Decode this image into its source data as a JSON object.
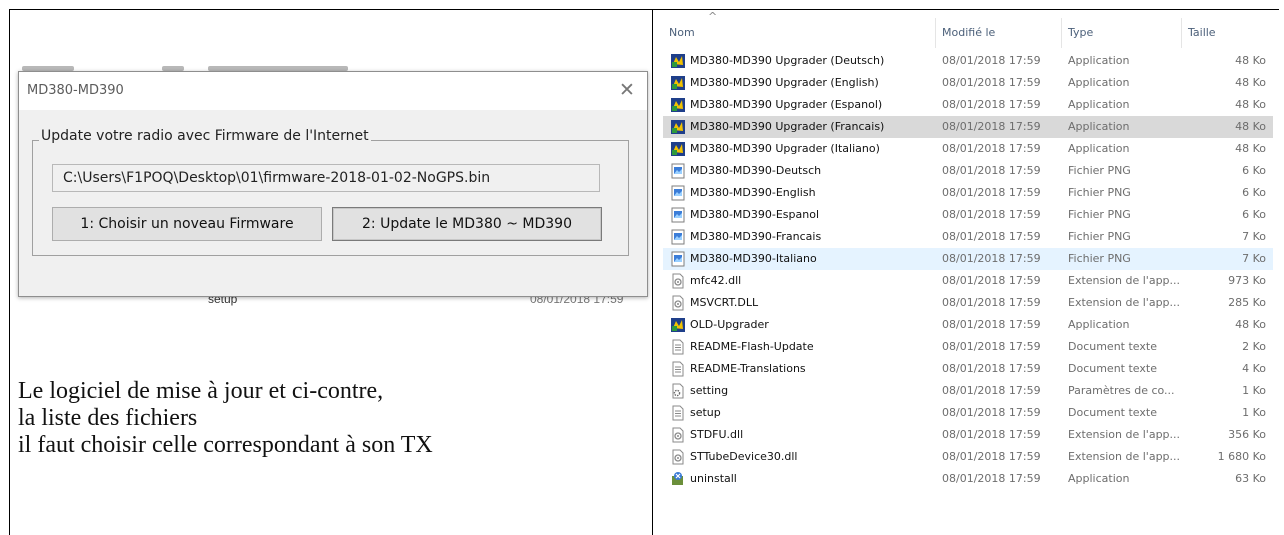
{
  "dialog": {
    "title": "MD380-MD390",
    "close_glyph": "✕",
    "group_label": "Update votre radio avec Firmware de l'Internet",
    "path": "C:\\Users\\F1POQ\\Desktop\\01\\firmware-2018-01-02-NoGPS.bin",
    "button_choose": "1: Choisir un noveau Firmware",
    "button_update": "2: Update le MD380 ~ MD390"
  },
  "background_window": {
    "bottom_item": "setup",
    "bottom_date": "08/01/2018 17:59"
  },
  "caption": {
    "line1": "Le logiciel de mise à jour et ci-contre,",
    "line2": "la liste des fichiers",
    "line3": "il faut choisir celle correspondant à son TX"
  },
  "explorer": {
    "sort_glyph": "^",
    "headers": {
      "name": "Nom",
      "modified": "Modifié le",
      "type": "Type",
      "size": "Taille"
    },
    "files": [
      {
        "name": "MD380-MD390 Upgrader (Deutsch)",
        "date": "08/01/2018 17:59",
        "type": "Application",
        "size": "48 Ko",
        "icon": "app-icon"
      },
      {
        "name": "MD380-MD390 Upgrader (English)",
        "date": "08/01/2018 17:59",
        "type": "Application",
        "size": "48 Ko",
        "icon": "app-icon"
      },
      {
        "name": "MD380-MD390 Upgrader (Espanol)",
        "date": "08/01/2018 17:59",
        "type": "Application",
        "size": "48 Ko",
        "icon": "app-icon"
      },
      {
        "name": "MD380-MD390 Upgrader (Francais)",
        "date": "08/01/2018 17:59",
        "type": "Application",
        "size": "48 Ko",
        "icon": "app-icon",
        "state": "selected"
      },
      {
        "name": "MD380-MD390 Upgrader (Italiano)",
        "date": "08/01/2018 17:59",
        "type": "Application",
        "size": "48 Ko",
        "icon": "app-icon"
      },
      {
        "name": "MD380-MD390-Deutsch",
        "date": "08/01/2018 17:59",
        "type": "Fichier PNG",
        "size": "6 Ko",
        "icon": "image-icon"
      },
      {
        "name": "MD380-MD390-English",
        "date": "08/01/2018 17:59",
        "type": "Fichier PNG",
        "size": "6 Ko",
        "icon": "image-icon"
      },
      {
        "name": "MD380-MD390-Espanol",
        "date": "08/01/2018 17:59",
        "type": "Fichier PNG",
        "size": "6 Ko",
        "icon": "image-icon"
      },
      {
        "name": "MD380-MD390-Francais",
        "date": "08/01/2018 17:59",
        "type": "Fichier PNG",
        "size": "7 Ko",
        "icon": "image-icon"
      },
      {
        "name": "MD380-MD390-Italiano",
        "date": "08/01/2018 17:59",
        "type": "Fichier PNG",
        "size": "7 Ko",
        "icon": "image-icon",
        "state": "hover"
      },
      {
        "name": "mfc42.dll",
        "date": "08/01/2018 17:59",
        "type": "Extension de l'app...",
        "size": "973 Ko",
        "icon": "dll-icon"
      },
      {
        "name": "MSVCRT.DLL",
        "date": "08/01/2018 17:59",
        "type": "Extension de l'app...",
        "size": "285 Ko",
        "icon": "dll-icon"
      },
      {
        "name": "OLD-Upgrader",
        "date": "08/01/2018 17:59",
        "type": "Application",
        "size": "48 Ko",
        "icon": "app-icon"
      },
      {
        "name": "README-Flash-Update",
        "date": "08/01/2018 17:59",
        "type": "Document texte",
        "size": "2 Ko",
        "icon": "text-doc-icon"
      },
      {
        "name": "README-Translations",
        "date": "08/01/2018 17:59",
        "type": "Document texte",
        "size": "4 Ko",
        "icon": "text-doc-icon"
      },
      {
        "name": "setting",
        "date": "08/01/2018 17:59",
        "type": "Paramètres de co...",
        "size": "1 Ko",
        "icon": "settings-file-icon"
      },
      {
        "name": "setup",
        "date": "08/01/2018 17:59",
        "type": "Document texte",
        "size": "1 Ko",
        "icon": "text-doc-icon"
      },
      {
        "name": "STDFU.dll",
        "date": "08/01/2018 17:59",
        "type": "Extension de l'app...",
        "size": "356 Ko",
        "icon": "dll-icon"
      },
      {
        "name": "STTubeDevice30.dll",
        "date": "08/01/2018 17:59",
        "type": "Extension de l'app...",
        "size": "1 680 Ko",
        "icon": "dll-icon"
      },
      {
        "name": "uninstall",
        "date": "08/01/2018 17:59",
        "type": "Application",
        "size": "63 Ko",
        "icon": "uninstall-icon"
      }
    ]
  },
  "colors": {
    "selected_row": "#d9d9d9",
    "hover_row": "#e5f3ff",
    "dialog_bg": "#f0f0f0"
  }
}
